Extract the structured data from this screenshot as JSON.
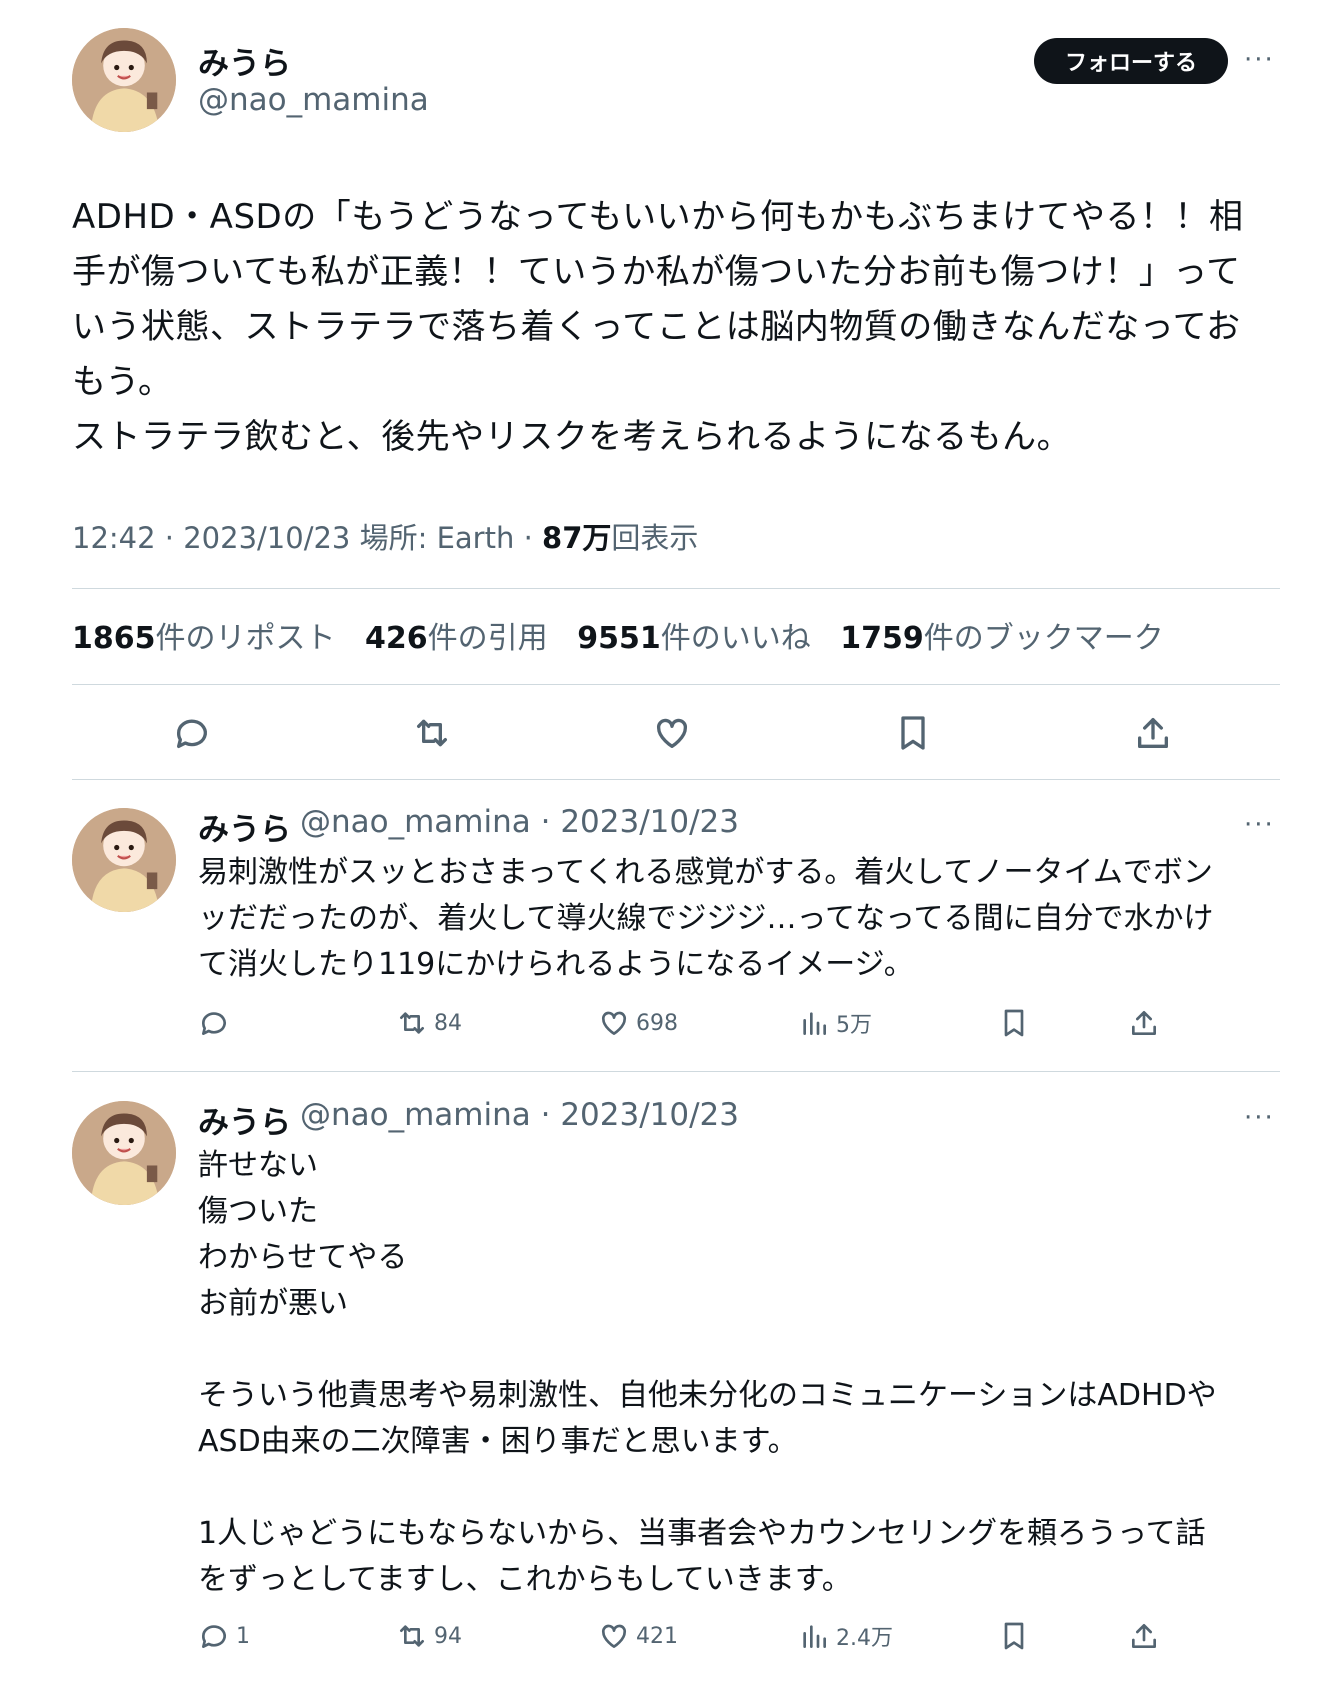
{
  "main_tweet": {
    "name": "みうら",
    "handle": "@nao_mamina",
    "follow_label": "フォローする",
    "more": "···",
    "text": "ADHD・ASDの「もうどうなってもいいから何もかもぶちまけてやる！！相\n手が傷ついても私が正義！！ていうか私が傷ついた分お前も傷つけ！」って\nいう状態、ストラテラで落ち着くってことは脳内物質の働きなんだなってお\nもう。\nストラテラ飲むと、後先やリスクを考えられるようになるもん。",
    "meta_prefix": "12:42 · 2023/10/23 場所: Earth · ",
    "views_value": "87万",
    "views_label": "回表示",
    "stats": [
      {
        "value": "1865",
        "label": "件のリポスト"
      },
      {
        "value": "426",
        "label": "件の引用"
      },
      {
        "value": "9551",
        "label": "件のいいね"
      },
      {
        "value": "1759",
        "label": "件のブックマーク"
      }
    ],
    "actions": [
      "reply-icon",
      "repost-icon",
      "like-icon",
      "bookmark-icon",
      "share-icon"
    ]
  },
  "replies": [
    {
      "name": "みうら",
      "handle": "@nao_mamina",
      "date": "· 2023/10/23",
      "more": "···",
      "text": "易刺激性がスッとおさまってくれる感覚がする。着火してノータイムでボン\nッだだったのが、着火して導火線でジジジ…ってなってる間に自分で水かけ\nて消火したり119にかけられるようになるイメージ。",
      "counts": {
        "reply": "",
        "repost": "84",
        "like": "698",
        "views": "5万"
      }
    },
    {
      "name": "みうら",
      "handle": "@nao_mamina",
      "date": "· 2023/10/23",
      "more": "···",
      "text": "許せない\n傷ついた\nわからせてやる\nお前が悪い\n\nそういう他責思考や易刺激性、自他未分化のコミュニケーションはADHDや\nASD由来の二次障害・困り事だと思います。\n\n1人じゃどうにもならないから、当事者会やカウンセリングを頼ろうって話\nをずっとしてますし、これからもしていきます。",
      "counts": {
        "reply": "1",
        "repost": "94",
        "like": "421",
        "views": "2.4万"
      }
    }
  ],
  "colors": {
    "text": "#0f1419",
    "muted": "#536471",
    "divider": "#cfd9de",
    "button": "#0f1419"
  }
}
